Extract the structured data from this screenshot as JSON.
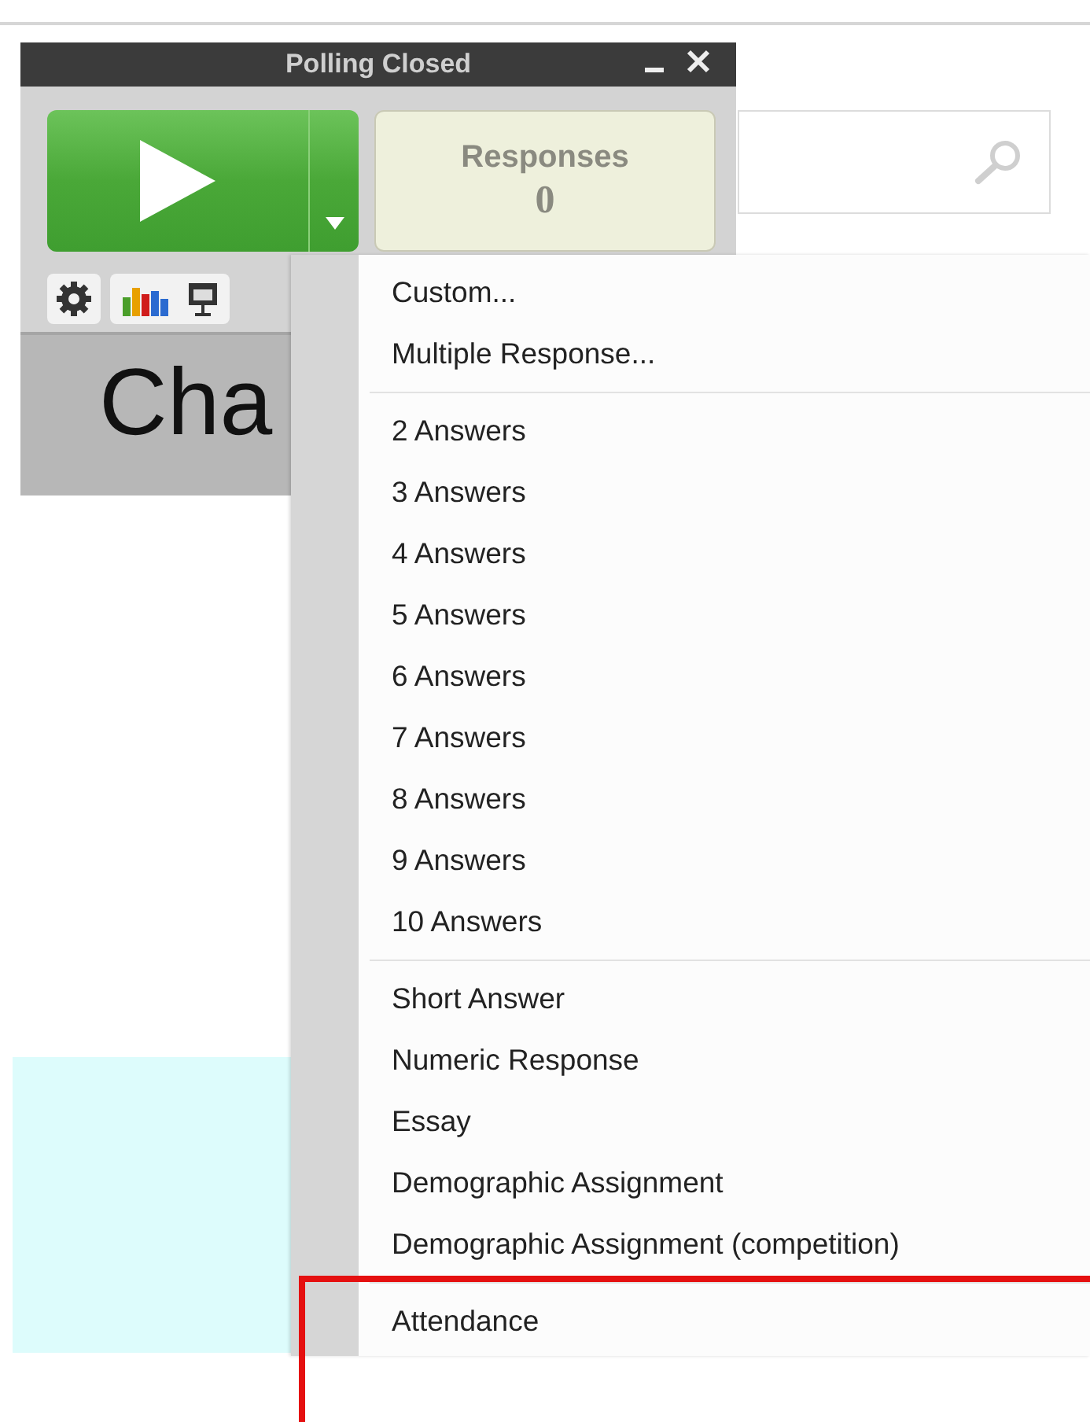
{
  "panel": {
    "title": "Polling Closed",
    "responses": {
      "label": "Responses",
      "count": "0"
    },
    "content_text": "Cha"
  },
  "question_type_menu": {
    "groups": [
      {
        "items": [
          "Custom...",
          "Multiple Response..."
        ]
      },
      {
        "items": [
          "2 Answers",
          "3 Answers",
          "4 Answers",
          "5 Answers",
          "6 Answers",
          "7 Answers",
          "8 Answers",
          "9 Answers",
          "10 Answers"
        ]
      },
      {
        "items": [
          "Short Answer",
          "Numeric Response",
          "Essay",
          "Demographic Assignment",
          "Demographic Assignment (competition)"
        ]
      },
      {
        "items": [
          "Attendance"
        ]
      }
    ]
  }
}
